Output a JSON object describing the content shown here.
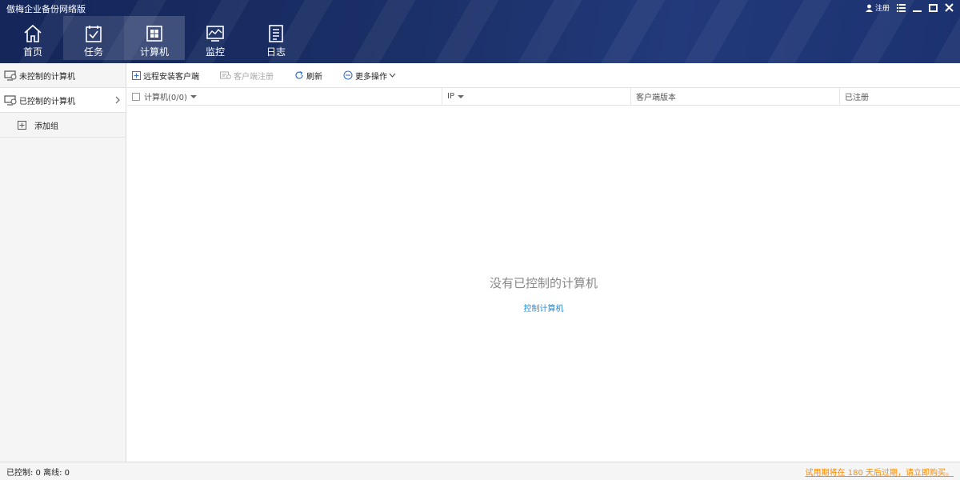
{
  "app": {
    "title": "傲梅企业备份网络版"
  },
  "window_controls": {
    "register_label": "注册"
  },
  "nav": {
    "items": [
      {
        "label": "首页",
        "icon": "home-icon"
      },
      {
        "label": "任务",
        "icon": "task-icon"
      },
      {
        "label": "计算机",
        "icon": "computer-icon"
      },
      {
        "label": "监控",
        "icon": "monitor-icon"
      },
      {
        "label": "日志",
        "icon": "log-icon"
      }
    ],
    "selected": "计算机"
  },
  "sidebar": {
    "items": [
      {
        "label": "未控制的计算机"
      },
      {
        "label": "已控制的计算机"
      },
      {
        "label": "添加组"
      }
    ]
  },
  "toolbar": {
    "remote_install": "远程安装客户端",
    "client_register": "客户端注册",
    "refresh": "刷新",
    "more": "更多操作"
  },
  "table": {
    "columns": [
      "计算机(0/0)",
      "IP",
      "客户端版本",
      "已注册"
    ]
  },
  "empty": {
    "message": "没有已控制的计算机",
    "link": "控制计算机"
  },
  "status": {
    "left": "已控制: 0 离线: 0",
    "right": "试用期将在 180 天后过期，请立即购买。"
  }
}
